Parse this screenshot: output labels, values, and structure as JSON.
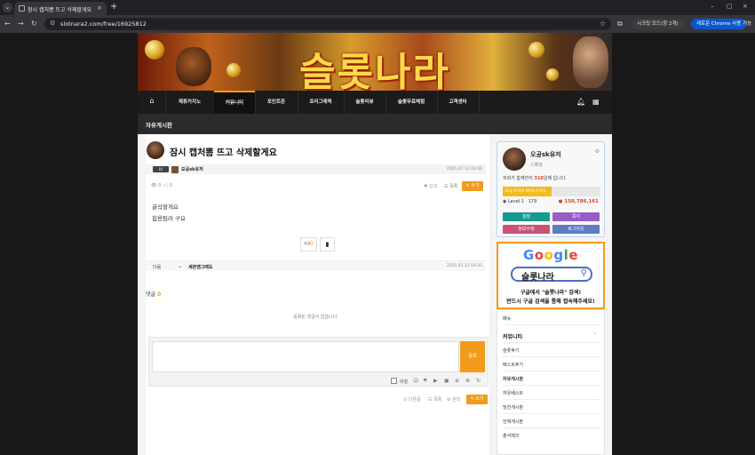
{
  "browser": {
    "tab_title": "잠시 캡처뽐 뜨고 삭제할게요",
    "url": "slotnara2.com/free/16925812",
    "secret_pill": "시크릿 모드(창 2개)",
    "chrome_pill": "새로운 Chrome 사용 가능"
  },
  "site": {
    "banner_logo": "슬롯나라",
    "nav": [
      "제휴카지노",
      "커뮤니티",
      "포인트존",
      "프리그래픽",
      "슬롯리뷰",
      "슬롯무료체험",
      "고객센터"
    ],
    "board_title": "자유게시판",
    "accent_color": "#f29b1a"
  },
  "post": {
    "title": "잠시 캡처뽐 뜨고 삭제할게요",
    "level_badge": "LV",
    "author": "오공sk유저",
    "date": "2025.07.12 03:06",
    "views": "0",
    "likes_count": "0",
    "report": "신고",
    "list_action": "목록",
    "list_btn": "목록",
    "write_btn": "쓰기",
    "content": [
      "글삭할게요",
      "힙용팀러 구요"
    ],
    "like_btn_count": "0",
    "next_label": "다음",
    "next_title": "세븐앤그래도",
    "next_date": "2025.07.12 03:35"
  },
  "comments": {
    "label": "댓글",
    "count": "0",
    "empty_msg": "등록된 댓글이 없습니다.",
    "submit": "등록",
    "secret": "비밀",
    "bottom_links": [
      "다른글",
      "목록",
      "관리"
    ],
    "write_btn": "쓰기"
  },
  "profile": {
    "name": "오공sk유저",
    "role": "스페셜",
    "days_prefix": "저희가 함께한지 ",
    "days_num": "310",
    "days_suffix": "일째 입니다.",
    "exp_text": "Exp 0.0/0.00% 0.0%",
    "exp_fraction": 0.5,
    "level": "Level 1 · 179",
    "points": "150,786,161",
    "buttons": [
      "설정",
      "쪽지",
      "정보수정",
      "로그아웃"
    ]
  },
  "google_ad": {
    "logo": "Google",
    "search_text": "슬롯나라",
    "line1": "구글에서 \"슬롯나라\" 검색!",
    "line2": "반드시 구글 검색을 통해 접속해주세요!"
  },
  "side_menu": {
    "top_item": "메뉴",
    "head": "커뮤니티",
    "items": [
      "슬롯후기",
      "베스트후기",
      "자유게시판",
      "자유베스트",
      "빙천게시판",
      "언체게시판",
      "출석체크"
    ]
  }
}
